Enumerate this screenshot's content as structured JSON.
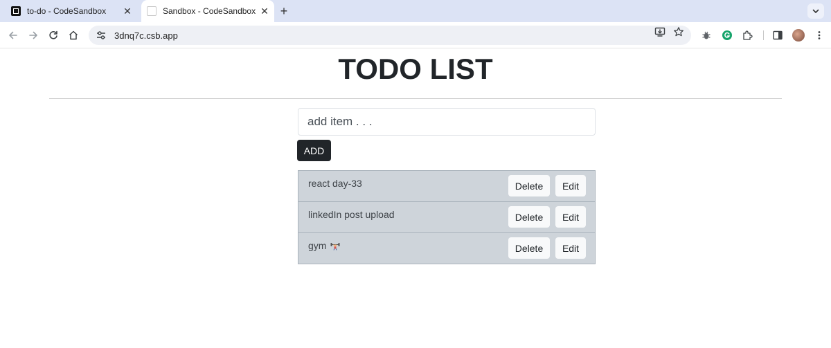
{
  "browser": {
    "tabs": [
      {
        "title": "to-do - CodeSandbox",
        "close": "✕"
      },
      {
        "title": "Sandbox - CodeSandbox",
        "close": "✕"
      }
    ],
    "new_tab": "+",
    "url": "3dnq7c.csb.app"
  },
  "page": {
    "title": "TODO LIST",
    "input_placeholder": "add item . . .",
    "add_label": "ADD"
  },
  "todos": [
    {
      "text": "react day-33",
      "delete": "Delete",
      "edit": "Edit"
    },
    {
      "text": "linkedIn post upload",
      "delete": "Delete",
      "edit": "Edit"
    },
    {
      "text": "gym",
      "delete": "Delete",
      "edit": "Edit"
    }
  ]
}
